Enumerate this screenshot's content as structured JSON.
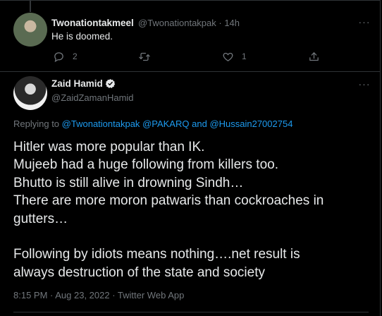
{
  "reply_tweet": {
    "display_name": "Twonationtakmeel",
    "handle_time": "@Twonationtakpak · 14h",
    "text": "He is doomed.",
    "reply_count": "2",
    "like_count": "1",
    "more_label": "···"
  },
  "main_tweet": {
    "display_name": "Zaid Hamid",
    "handle": "@ZaidZamanHamid",
    "more_label": "···",
    "replying_prefix": "Replying to",
    "replying_users": [
      "@Twonationtakpak",
      "@PAKARQ",
      "and",
      "@Hussain27002754"
    ],
    "text_lines": [
      "Hitler was more popular than IK.",
      "Mujeeb had a huge following from killers too.",
      "Bhutto is still alive in drowning Sindh…",
      "There are more moron patwaris than cockroaches in",
      "gutters…",
      "",
      "Following by idiots means nothing….net result is",
      "always destruction of the state and society"
    ],
    "timestamp": "8:15 PM · Aug 23, 2022 · Twitter Web App"
  },
  "icons": {
    "reply": "reply-icon",
    "retweet": "retweet-icon",
    "like": "heart-icon",
    "share": "share-icon",
    "verified": "verified-badge-icon",
    "more": "more-icon"
  },
  "colors": {
    "background": "#000000",
    "text": "#e7e9ea",
    "secondary": "#71767b",
    "link": "#1d9bf0",
    "border": "#2f3336"
  }
}
